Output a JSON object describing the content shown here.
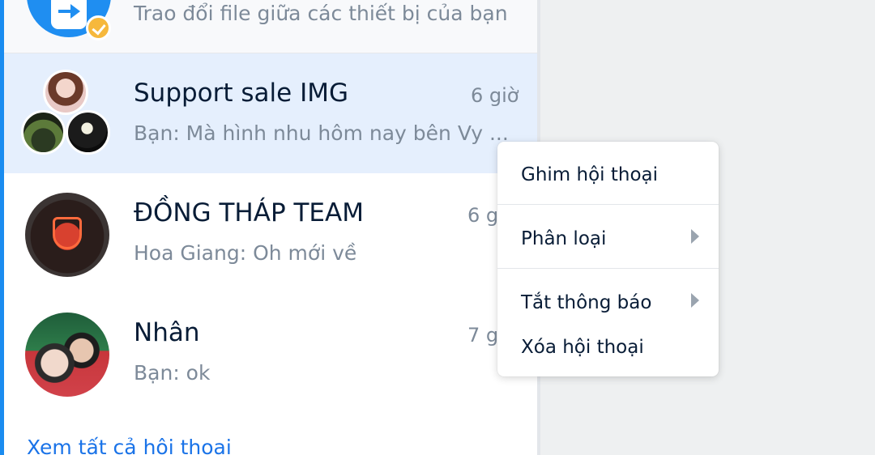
{
  "conversations": [
    {
      "kind": "file-transfer",
      "preview": "Trao đổi file giữa các thiết bị của bạn"
    },
    {
      "kind": "group",
      "title": "Support sale IMG",
      "time": "6 giờ",
      "preview": "Bạn: Mà hình nhu hôm nay bên Vy ...",
      "selected": true
    },
    {
      "kind": "group",
      "title": "ĐỒNG THÁP TEAM",
      "time": "6 g",
      "preview": "Hoa Giang: Oh mới về"
    },
    {
      "kind": "direct",
      "title": "Nhân",
      "time": "7 g",
      "preview": "Bạn: ok"
    }
  ],
  "footer": {
    "see_all_link": "Xem tất cả hội thoại"
  },
  "context_menu": {
    "items": [
      {
        "label": "Ghim hội thoại",
        "has_submenu": false
      },
      {
        "label": "Phân loại",
        "has_submenu": true
      },
      {
        "label": "Tắt thông báo",
        "has_submenu": true
      },
      {
        "label": "Xóa hội thoại",
        "has_submenu": false
      }
    ]
  },
  "colors": {
    "accent": "#1a8cf0",
    "selected_row": "#e5effd",
    "link": "#1a73e8",
    "badge": "#f6b83c"
  }
}
